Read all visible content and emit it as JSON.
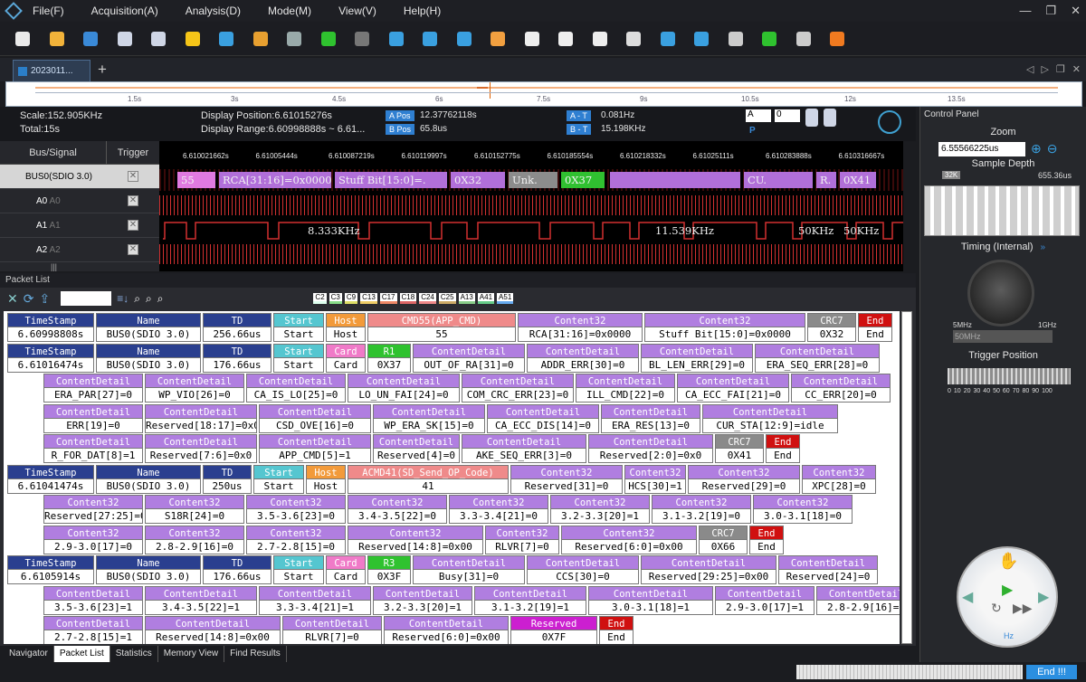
{
  "menus": [
    "File(F)",
    "Acquisition(A)",
    "Analysis(D)",
    "Mode(M)",
    "View(V)",
    "Help(H)"
  ],
  "toolbar_icons": [
    "new-file-icon",
    "open-folder-icon",
    "save-icon",
    "print-icon",
    "save-as-icon",
    "favorite-star-icon",
    "stamp-icon",
    "tools-icon",
    "settings-gear-icon",
    "run-icon",
    "stop-icon",
    "marker-add-icon",
    "marker-blue-icon",
    "marker-flag-icon",
    "search-light-icon",
    "pages-icon",
    "pages-alt-icon",
    "pages-alt2-icon",
    "binary-icon",
    "zoom-in-icon",
    "zoom-out-icon",
    "zoom-reset-icon",
    "zoom-fit-icon",
    "pointer-icon",
    "help-lifebuoy-icon"
  ],
  "tab": {
    "label": "2023011..."
  },
  "overview_ticks": [
    "1.5s",
    "3s",
    "4.5s",
    "6s",
    "7.5s",
    "9s",
    "10.5s",
    "12s",
    "13.5s"
  ],
  "info": {
    "scale": "Scale:152.905KHz",
    "total": "Total:15s",
    "display_position": "Display Position:6.61015276s",
    "display_range": "Display Range:6.60998888s ~ 6.61...",
    "apos_label": "A Pos",
    "apos_value": "12.37762118s",
    "bpos_label": "B Pos",
    "bpos_value": "65.8us",
    "at_label": "A - T",
    "at_value": "0.081Hz",
    "bt_label": "B - T",
    "bt_value": "15.198KHz",
    "cursor_a": "A",
    "cursor_b": "0",
    "p_label": "P"
  },
  "channels": {
    "header_bus": "Bus/Signal",
    "header_trigger": "Trigger",
    "rows": [
      {
        "name": "BUS0(SDIO 3.0)",
        "trig": "✕"
      },
      {
        "name": "A0",
        "sub": "A0",
        "trig": "✕"
      },
      {
        "name": "A1",
        "sub": "A1",
        "trig": "✕"
      },
      {
        "name": "A2",
        "sub": "A2",
        "trig": "✕"
      }
    ]
  },
  "time_labels": [
    "6.610021662s",
    "6.61005444s",
    "6.610087219s",
    "6.610119997s",
    "6.610152775s",
    "6.610185554s",
    "6.610218332s",
    "6.61025111s",
    "6.610283888s",
    "6.610316667s"
  ],
  "bus_segments": [
    {
      "text": "55",
      "color": "#e07ae0"
    },
    {
      "text": "RCA[31:16]=0x0000",
      "color": "#b16fd9"
    },
    {
      "text": "Stuff Bit[15:0]=.",
      "color": "#b16fd9"
    },
    {
      "text": "0X32",
      "color": "#b16fd9"
    },
    {
      "text": "Unk.",
      "color": "#8c8c8c"
    },
    {
      "text": "0X37",
      "color": "#30c030"
    },
    {
      "text": "",
      "color": "#b16fd9"
    },
    {
      "text": "CU.",
      "color": "#b16fd9"
    },
    {
      "text": "R.",
      "color": "#b16fd9"
    },
    {
      "text": "0X41",
      "color": "#b16fd9"
    }
  ],
  "freqs": [
    "8.333KHz",
    "11.539KHz",
    "50KHz",
    "50KHz"
  ],
  "control_panel": {
    "title": "Control Panel",
    "zoom_title": "Zoom",
    "zoom_value": "6.55566225us",
    "sample_depth_title": "Sample Depth",
    "depth_marker": "32K",
    "depth_value": "655.36us",
    "timing_title": "Timing (Internal)",
    "knob_min": "5MHz",
    "knob_max": "1GHz",
    "rate": "50MHz",
    "trigger_title": "Trigger Position",
    "trigger_ticks": [
      "0",
      "10",
      "20",
      "30",
      "40",
      "50",
      "60",
      "70",
      "80",
      "90",
      "100"
    ],
    "trigger_pct": "%",
    "hz": "Hz"
  },
  "packet_list": {
    "title": "Packet List",
    "channel_chips": [
      "C2",
      "C3",
      "C9",
      "C13",
      "C17",
      "C18",
      "C24",
      "C25",
      "A13",
      "A41",
      "A51"
    ]
  },
  "packet_rows": [
    [
      {
        "h": "TimeStamp",
        "v": "6.60998808s",
        "t": "ts"
      },
      {
        "h": "Name",
        "v": "BUS0(SDIO 3.0)",
        "t": "ts"
      },
      {
        "h": "TD",
        "v": "256.66us",
        "t": "ts"
      },
      {
        "h": "Start",
        "v": "Start",
        "t": "start"
      },
      {
        "h": "Host",
        "v": "Host",
        "t": "host"
      },
      {
        "h": "CMD55(APP_CMD)",
        "v": "55",
        "t": "cmd"
      },
      {
        "h": "Content32",
        "v": "RCA[31:16]=0x0000",
        "t": "content"
      },
      {
        "h": "Content32",
        "v": "Stuff Bit[15:0]=0x0000",
        "t": "content"
      },
      {
        "h": "CRC7",
        "v": "0X32",
        "t": "crc"
      },
      {
        "h": "End",
        "v": "End",
        "t": "end"
      }
    ],
    [
      {
        "h": "TimeStamp",
        "v": "6.61016474s",
        "t": "ts"
      },
      {
        "h": "Name",
        "v": "BUS0(SDIO 3.0)",
        "t": "ts"
      },
      {
        "h": "TD",
        "v": "176.66us",
        "t": "ts"
      },
      {
        "h": "Start",
        "v": "Start",
        "t": "start"
      },
      {
        "h": "Card",
        "v": "Card",
        "t": "card"
      },
      {
        "h": "R1",
        "v": "0X37",
        "t": "r1"
      },
      {
        "h": "ContentDetail",
        "v": "OUT_OF_RA[31]=0",
        "t": "content"
      },
      {
        "h": "ContentDetail",
        "v": "ADDR_ERR[30]=0",
        "t": "content"
      },
      {
        "h": "ContentDetail",
        "v": "BL_LEN_ERR[29]=0",
        "t": "content"
      },
      {
        "h": "ContentDetail",
        "v": "ERA_SEQ_ERR[28]=0",
        "t": "content"
      }
    ],
    [
      {
        "h": "ContentDetail",
        "v": "ERA_PAR[27]=0",
        "t": "content"
      },
      {
        "h": "ContentDetail",
        "v": "WP_VIO[26]=0",
        "t": "content"
      },
      {
        "h": "ContentDetail",
        "v": "CA_IS_LO[25]=0",
        "t": "content"
      },
      {
        "h": "ContentDetail",
        "v": "LO_UN_FAI[24]=0",
        "t": "content"
      },
      {
        "h": "ContentDetail",
        "v": "COM_CRC_ERR[23]=0",
        "t": "content"
      },
      {
        "h": "ContentDetail",
        "v": "ILL_CMD[22]=0",
        "t": "content"
      },
      {
        "h": "ContentDetail",
        "v": "CA_ECC_FAI[21]=0",
        "t": "content"
      },
      {
        "h": "ContentDetail",
        "v": "CC_ERR[20]=0",
        "t": "content"
      }
    ],
    [
      {
        "h": "ContentDetail",
        "v": "ERR[19]=0",
        "t": "content"
      },
      {
        "h": "ContentDetail",
        "v": "Reserved[18:17]=0x0",
        "t": "content"
      },
      {
        "h": "ContentDetail",
        "v": "CSD_OVE[16]=0",
        "t": "content"
      },
      {
        "h": "ContentDetail",
        "v": "WP_ERA_SK[15]=0",
        "t": "content"
      },
      {
        "h": "ContentDetail",
        "v": "CA_ECC_DIS[14]=0",
        "t": "content"
      },
      {
        "h": "ContentDetail",
        "v": "ERA_RES[13]=0",
        "t": "content"
      },
      {
        "h": "ContentDetail",
        "v": "CUR_STA[12:9]=idle",
        "t": "content"
      }
    ],
    [
      {
        "h": "ContentDetail",
        "v": "R_FOR_DAT[8]=1",
        "t": "content"
      },
      {
        "h": "ContentDetail",
        "v": "Reserved[7:6]=0x0",
        "t": "content"
      },
      {
        "h": "ContentDetail",
        "v": "APP_CMD[5]=1",
        "t": "content"
      },
      {
        "h": "ContentDetail",
        "v": "Reserved[4]=0",
        "t": "content"
      },
      {
        "h": "ContentDetail",
        "v": "AKE_SEQ_ERR[3]=0",
        "t": "content"
      },
      {
        "h": "ContentDetail",
        "v": "Reserved[2:0]=0x0",
        "t": "content"
      },
      {
        "h": "CRC7",
        "v": "0X41",
        "t": "crc"
      },
      {
        "h": "End",
        "v": "End",
        "t": "end"
      }
    ],
    [
      {
        "h": "TimeStamp",
        "v": "6.61041474s",
        "t": "ts"
      },
      {
        "h": "Name",
        "v": "BUS0(SDIO 3.0)",
        "t": "ts"
      },
      {
        "h": "TD",
        "v": "250us",
        "t": "ts"
      },
      {
        "h": "Start",
        "v": "Start",
        "t": "start"
      },
      {
        "h": "Host",
        "v": "Host",
        "t": "host"
      },
      {
        "h": "ACMD41(SD_Send_OP_Code)",
        "v": "41",
        "t": "cmd"
      },
      {
        "h": "Content32",
        "v": "Reserved[31]=0",
        "t": "content"
      },
      {
        "h": "Content32",
        "v": "HCS[30]=1",
        "t": "content"
      },
      {
        "h": "Content32",
        "v": "Reserved[29]=0",
        "t": "content"
      },
      {
        "h": "Content32",
        "v": "XPC[28]=0",
        "t": "content"
      }
    ],
    [
      {
        "h": "Content32",
        "v": "Reserved[27:25]=0x0",
        "t": "content"
      },
      {
        "h": "Content32",
        "v": "S18R[24]=0",
        "t": "content"
      },
      {
        "h": "Content32",
        "v": "3.5-3.6[23]=0",
        "t": "content"
      },
      {
        "h": "Content32",
        "v": "3.4-3.5[22]=0",
        "t": "content"
      },
      {
        "h": "Content32",
        "v": "3.3-3.4[21]=0",
        "t": "content"
      },
      {
        "h": "Content32",
        "v": "3.2-3.3[20]=1",
        "t": "content"
      },
      {
        "h": "Content32",
        "v": "3.1-3.2[19]=0",
        "t": "content"
      },
      {
        "h": "Content32",
        "v": "3.0-3.1[18]=0",
        "t": "content"
      }
    ],
    [
      {
        "h": "Content32",
        "v": "2.9-3.0[17]=0",
        "t": "content"
      },
      {
        "h": "Content32",
        "v": "2.8-2.9[16]=0",
        "t": "content"
      },
      {
        "h": "Content32",
        "v": "2.7-2.8[15]=0",
        "t": "content"
      },
      {
        "h": "Content32",
        "v": "Reserved[14:8]=0x00",
        "t": "content"
      },
      {
        "h": "Content32",
        "v": "RLVR[7]=0",
        "t": "content"
      },
      {
        "h": "Content32",
        "v": "Reserved[6:0]=0x00",
        "t": "content"
      },
      {
        "h": "CRC7",
        "v": "0X66",
        "t": "crc"
      },
      {
        "h": "End",
        "v": "End",
        "t": "end"
      }
    ],
    [
      {
        "h": "TimeStamp",
        "v": "6.6105914s",
        "t": "ts"
      },
      {
        "h": "Name",
        "v": "BUS0(SDIO 3.0)",
        "t": "ts"
      },
      {
        "h": "TD",
        "v": "176.66us",
        "t": "ts"
      },
      {
        "h": "Start",
        "v": "Start",
        "t": "start"
      },
      {
        "h": "Card",
        "v": "Card",
        "t": "card"
      },
      {
        "h": "R3",
        "v": "0X3F",
        "t": "r1"
      },
      {
        "h": "ContentDetail",
        "v": "Busy[31]=0",
        "t": "content"
      },
      {
        "h": "ContentDetail",
        "v": "CCS[30]=0",
        "t": "content"
      },
      {
        "h": "ContentDetail",
        "v": "Reserved[29:25]=0x00",
        "t": "content"
      },
      {
        "h": "ContentDetail",
        "v": "Reserved[24]=0",
        "t": "content"
      }
    ],
    [
      {
        "h": "ContentDetail",
        "v": "3.5-3.6[23]=1",
        "t": "content"
      },
      {
        "h": "ContentDetail",
        "v": "3.4-3.5[22]=1",
        "t": "content"
      },
      {
        "h": "ContentDetail",
        "v": "3.3-3.4[21]=1",
        "t": "content"
      },
      {
        "h": "ContentDetail",
        "v": "3.2-3.3[20]=1",
        "t": "content"
      },
      {
        "h": "ContentDetail",
        "v": "3.1-3.2[19]=1",
        "t": "content"
      },
      {
        "h": "ContentDetail",
        "v": "3.0-3.1[18]=1",
        "t": "content"
      },
      {
        "h": "ContentDetail",
        "v": "2.9-3.0[17]=1",
        "t": "content"
      },
      {
        "h": "ContentDetail",
        "v": "2.8-2.9[16]=1",
        "t": "content"
      }
    ],
    [
      {
        "h": "ContentDetail",
        "v": "2.7-2.8[15]=1",
        "t": "content"
      },
      {
        "h": "ContentDetail",
        "v": "Reserved[14:8]=0x00",
        "t": "content"
      },
      {
        "h": "ContentDetail",
        "v": "RLVR[7]=0",
        "t": "content"
      },
      {
        "h": "ContentDetail",
        "v": "Reserved[6:0]=0x00",
        "t": "content"
      },
      {
        "h": "Reserved",
        "v": "0X7F",
        "t": "reserved"
      },
      {
        "h": "End",
        "v": "End",
        "t": "end"
      }
    ]
  ],
  "header_colors": {
    "ts": "#2a3f8f",
    "start": "#55c6d0",
    "host": "#f29a3a",
    "card": "#f07ac8",
    "cmd": "#ef8a8a",
    "content": "#b07ee0",
    "r1": "#2fc22f",
    "crc": "#8a8a8a",
    "end": "#d01010",
    "reserved": "#cc1fd0"
  },
  "bottom_tabs": [
    "Navigator",
    "Packet List",
    "Statistics",
    "Memory View",
    "Find Results"
  ],
  "status": {
    "end_label": "End !!!"
  }
}
